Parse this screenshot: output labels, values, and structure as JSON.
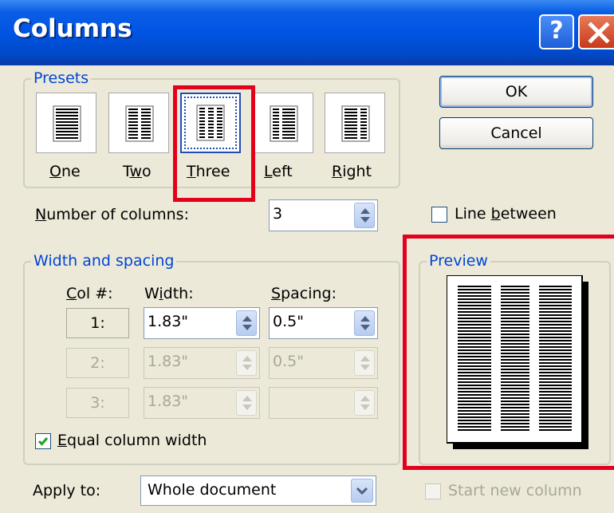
{
  "dialog": {
    "title": "Columns"
  },
  "presets": {
    "legend": "Presets",
    "items": [
      {
        "label": "One",
        "icon": "one-column-icon",
        "selected": false
      },
      {
        "label": "Two",
        "icon": "two-columns-icon",
        "selected": false
      },
      {
        "label": "Three",
        "icon": "three-columns-icon",
        "selected": true
      },
      {
        "label": "Left",
        "icon": "left-column-icon",
        "selected": false
      },
      {
        "label": "Right",
        "icon": "right-column-icon",
        "selected": false
      }
    ]
  },
  "buttons": {
    "ok": "OK",
    "cancel": "Cancel"
  },
  "number_of_columns": {
    "label": "Number of columns:",
    "value": "3"
  },
  "line_between": {
    "label": "Line between",
    "checked": false
  },
  "width_spacing": {
    "legend": "Width and spacing",
    "col_header": "Col #:",
    "width_header": "Width:",
    "spacing_header": "Spacing:",
    "rows": [
      {
        "col": "1:",
        "width": "1.83\"",
        "spacing": "0.5\"",
        "enabled": true
      },
      {
        "col": "2:",
        "width": "1.83\"",
        "spacing": "0.5\"",
        "enabled": false
      },
      {
        "col": "3:",
        "width": "1.83\"",
        "spacing": "",
        "enabled": false
      }
    ],
    "equal_width": {
      "label": "Equal column width",
      "checked": true
    }
  },
  "preview": {
    "legend": "Preview"
  },
  "apply_to": {
    "label": "Apply to:",
    "value": "Whole document"
  },
  "start_new_column": {
    "label": "Start new column",
    "checked": false
  },
  "colors": {
    "title_blue": "#0054E3",
    "highlight_red": "#E3001B",
    "dialog_bg": "#ECE9D8",
    "legend_blue": "#0046D5"
  }
}
